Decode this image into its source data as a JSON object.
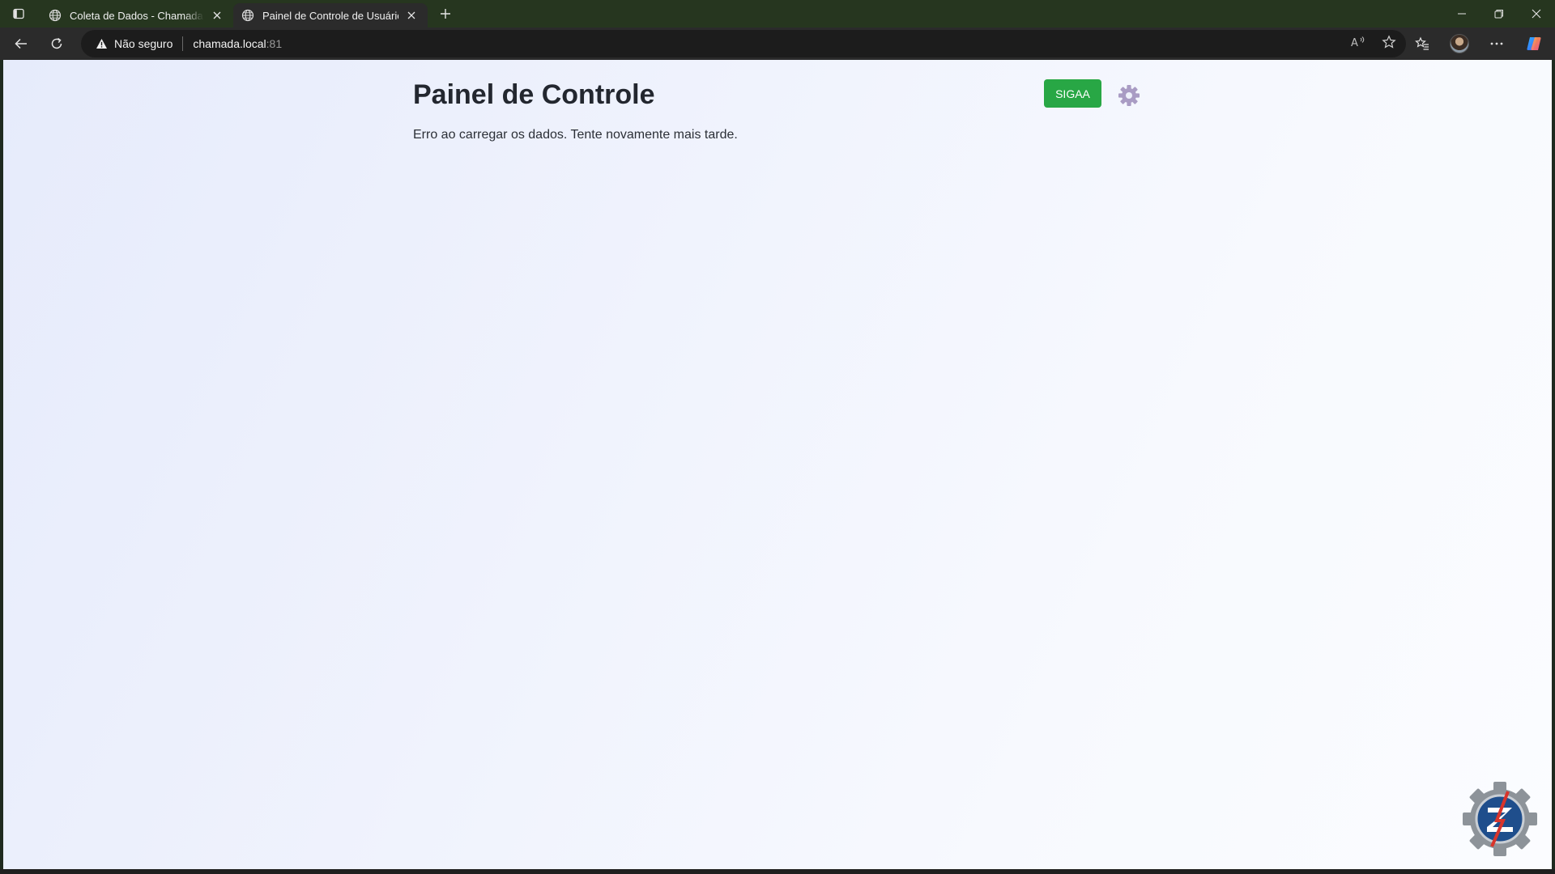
{
  "browser": {
    "tabs": [
      {
        "title": "Coleta de Dados - Chamada Local",
        "active": false
      },
      {
        "title": "Painel de Controle de Usuários",
        "active": true
      }
    ],
    "address": {
      "security_label": "Não seguro",
      "host": "chamada.local",
      "port": ":81"
    }
  },
  "page": {
    "title": "Painel de Controle",
    "status_message": "Erro ao carregar os dados. Tente novamente mais tarde.",
    "sigaa_label": "SIGAA"
  },
  "colors": {
    "sigaa_button": "#28a745",
    "tab_strip": "#26361f",
    "toolbar": "#2b2b2b"
  },
  "icons": [
    "tab-actions-icon",
    "globe-icon",
    "close-icon",
    "plus-icon",
    "minimize-icon",
    "restore-icon",
    "back-arrow-icon",
    "refresh-icon",
    "warning-icon",
    "read-aloud-icon",
    "star-icon",
    "favorites-icon",
    "more-icon",
    "copilot-icon",
    "gear-icon",
    "gear-logo-icon"
  ]
}
